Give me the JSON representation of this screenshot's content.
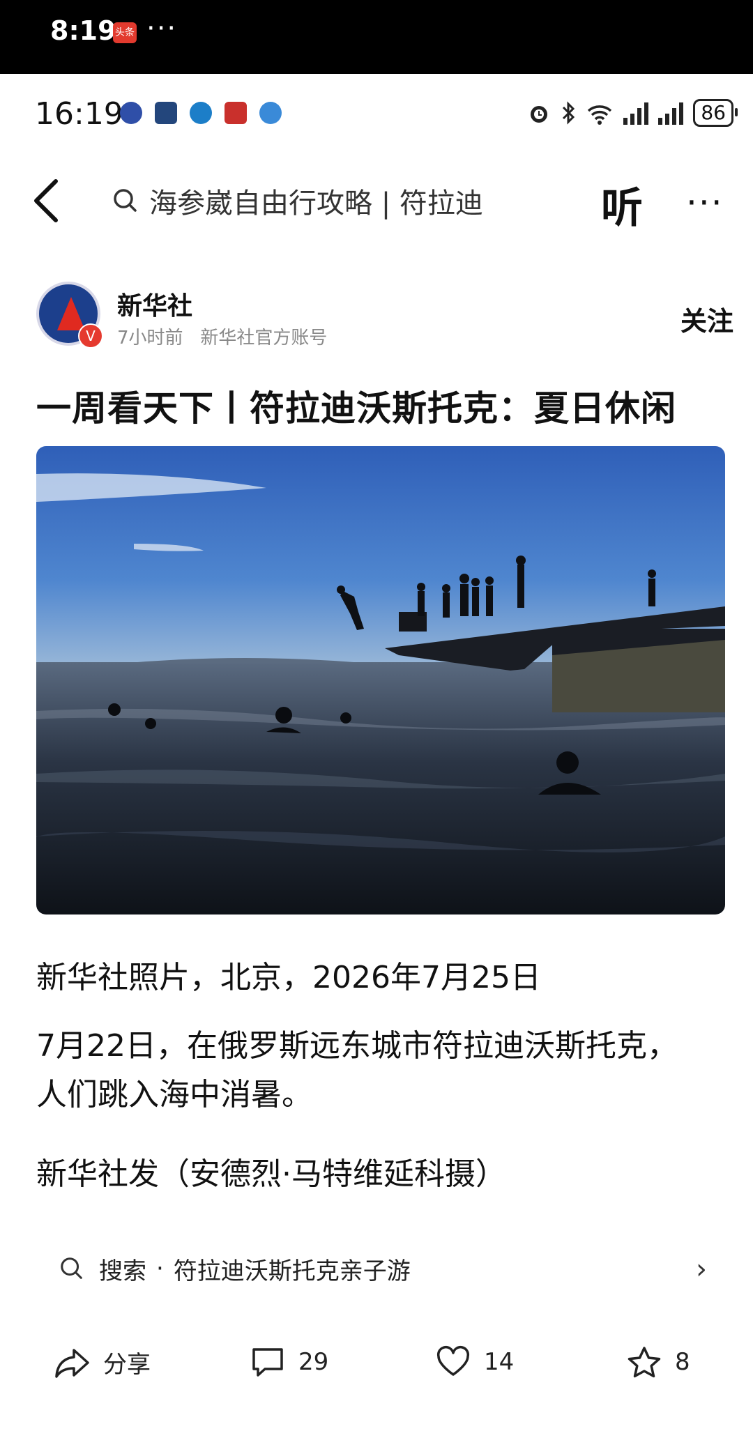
{
  "outer_status": {
    "time": "8:19",
    "app_badge": "头条",
    "more": "···"
  },
  "status_bar": {
    "time": "16:19",
    "battery": "86",
    "signal_icons": [
      "alarm-icon",
      "bluetooth-icon",
      "wifi-icon",
      "signal-icon",
      "signal-icon"
    ]
  },
  "nav": {
    "search_text": "海参崴自由行攻略 | 符拉迪",
    "listen_label": "听",
    "more": "···"
  },
  "author": {
    "name": "新华社",
    "time_ago": "7小时前",
    "meta": "新华社官方账号",
    "follow_label": "关注"
  },
  "article": {
    "title": "一周看天下丨符拉迪沃斯托克：夏日休闲",
    "caption_line": "新华社照片，北京，2026年7月25日",
    "body": "7月22日，在俄罗斯远东城市符拉迪沃斯托克，人们跳入海中消暑。",
    "credit": "新华社发（安德烈·马特维延科摄）"
  },
  "related_search": {
    "prefix": "搜索",
    "separator": "·",
    "query": "符拉迪沃斯托克亲子游"
  },
  "actions": {
    "share_label": "分享",
    "comments": "29",
    "likes": "14",
    "favorites": "8"
  }
}
